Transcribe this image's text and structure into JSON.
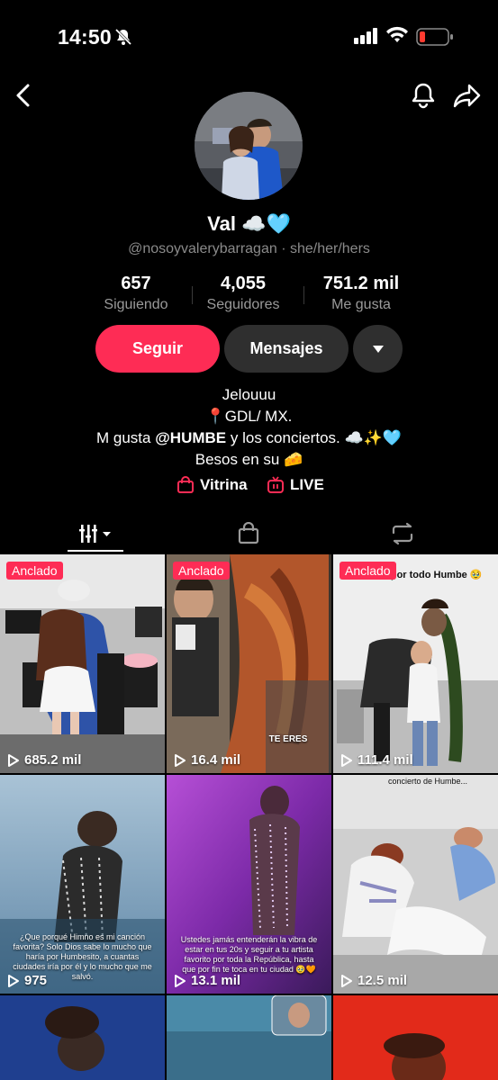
{
  "status_bar": {
    "time": "14:50"
  },
  "profile": {
    "name": "Val ☁️🩵",
    "handle": "@nosoyvalerybarragan · she/her/hers"
  },
  "stats": [
    {
      "value": "657",
      "label": "Siguiendo"
    },
    {
      "value": "4,055",
      "label": "Seguidores"
    },
    {
      "value": "751.2 mil",
      "label": "Me gusta"
    }
  ],
  "actions": {
    "follow": "Seguir",
    "messages": "Mensajes"
  },
  "bio": {
    "line1": "Jelouuu",
    "line2": "📍GDL/ MX.",
    "line3_pre": "M gusta ",
    "line3_mention": "@HUMBE",
    "line3_post": " y los conciertos. ☁️✨🩵",
    "line4": "Besos en su 🧀"
  },
  "links": {
    "showcase": "Vitrina",
    "live": "LIVE"
  },
  "colors": {
    "accent": "#fe2c55",
    "secondary_button": "#2f2f2f",
    "muted_text": "#8a8a8a"
  },
  "videos": [
    {
      "pinned": "Anclado",
      "views": "685.2 mil"
    },
    {
      "pinned": "Anclado",
      "views": "16.4 mil",
      "overlay": "TE ERES"
    },
    {
      "pinned": "Anclado",
      "views": "111.4 mil",
      "overlay": "Gracias por todo Humbe 🥹"
    },
    {
      "views": "975",
      "overlay": "¿Que porqué Himno es mi canción favorita? Solo Dios sabe lo mucho que haría por Humbesito, a cuantas ciudades iría por él y lo mucho que me salvó."
    },
    {
      "views": "13.1 mil",
      "overlay": "Ustedes jamás entenderán la vibra de estar en tus 20s y seguir a tu artista favorito por toda la República, hasta que por fin te toca en tu ciudad 🥹🧡"
    },
    {
      "views": "12.5 mil",
      "overlay": "concierto de Humbe..."
    }
  ]
}
